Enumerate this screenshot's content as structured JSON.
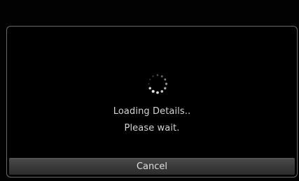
{
  "dialog": {
    "spinner_icon": "loading-spinner-icon",
    "message_line1": "Loading Details..",
    "message_line2": "Please wait.",
    "cancel_label": "Cancel"
  },
  "colors": {
    "background": "#000000",
    "dialog_border": "#6a6a6a",
    "text": "#d4d4d4",
    "button": "#3a3a3a"
  }
}
